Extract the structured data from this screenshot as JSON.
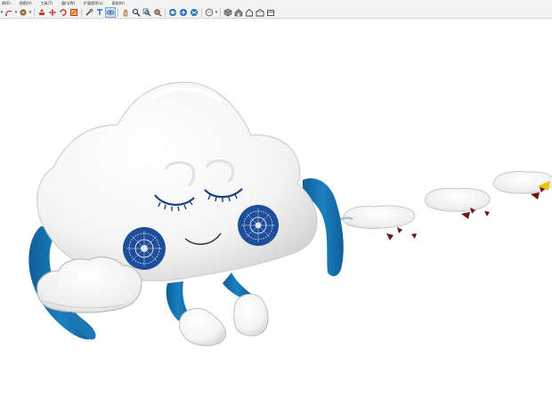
{
  "menubar": {
    "items": [
      "视(E)",
      "视图(V)",
      "工具(T)",
      "窗口(W)",
      "扩展程序(x)",
      "帮助(H)"
    ]
  },
  "toolbar": {
    "buttons": [
      {
        "icon": "select-caret-icon"
      },
      {
        "icon": "arc-tool-icon"
      },
      {
        "icon": "paint-bucket-icon"
      },
      {
        "icon": "push-pull-icon"
      },
      {
        "icon": "move-icon"
      },
      {
        "icon": "rotate-icon"
      },
      {
        "icon": "scale-icon"
      },
      {
        "icon": "tape-measure-icon"
      },
      {
        "icon": "text-tool-icon"
      },
      {
        "icon": "orbit-icon"
      },
      {
        "icon": "pan-icon"
      },
      {
        "icon": "zoom-icon"
      },
      {
        "icon": "zoom-window-icon"
      },
      {
        "icon": "zoom-extents-icon"
      },
      {
        "icon": "section-plane-icon"
      },
      {
        "icon": "section-display-icon"
      },
      {
        "icon": "section-cut-icon"
      },
      {
        "icon": "styles-icon"
      },
      {
        "icon": "iso-view-icon"
      },
      {
        "icon": "top-view-icon"
      },
      {
        "icon": "front-view-icon"
      },
      {
        "icon": "right-view-icon"
      },
      {
        "icon": "back-view-icon"
      }
    ],
    "accent_color": "#1f6fbf"
  },
  "scene": {
    "character_color": "#f7f7f7",
    "limb_color": "#1b76b3",
    "cheek_color": "#1e4e9a",
    "eye_color": "#1b3f80",
    "debris_color": "#6e1414"
  }
}
